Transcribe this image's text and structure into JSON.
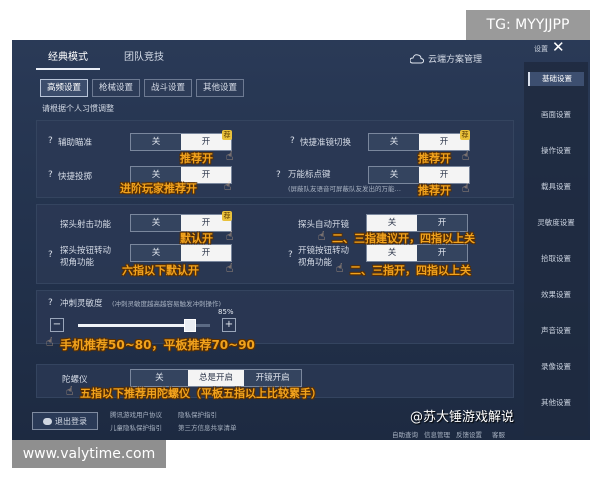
{
  "watermark_top": "TG: MYYJJPP",
  "watermark_bottom": "www.valytime.com",
  "watermark_corner": "@苏大锤游戏解说",
  "header": {
    "tabs": [
      "经典模式",
      "团队竞技"
    ],
    "cloud_label": "云端方案管理",
    "corner_text": "设置",
    "close_glyph": "✕"
  },
  "subtabs": [
    "高频设置",
    "枪械设置",
    "战斗设置",
    "其他设置"
  ],
  "instruction": "请根据个人习惯调整",
  "toggle": {
    "off": "关",
    "on": "开"
  },
  "settings": {
    "aim_assist": "辅助瞄准",
    "quick_throw": "快捷投掷",
    "quick_scope_switch": "快捷准镜切换",
    "universal_marker": "万能标点键",
    "universal_marker_note": "(屏蔽队友语音可屏蔽队友发出的万能…",
    "peek_fire": "探头射击功能",
    "peek_auto_scope": "探头自动开镜",
    "peek_button_line1": "探头按钮转动",
    "peek_button_line2": "视角功能",
    "scope_button_line1": "开镜按钮转动",
    "scope_button_line2": "视角功能",
    "sensitivity": "冲刺灵敏度",
    "sensitivity_note": "(冲刺灵敏度越高越容易触发冲刺操作)",
    "sensitivity_value": "85%",
    "sensitivity_level": 0.85,
    "minus": "−",
    "plus": "+",
    "gyro": "陀螺仪",
    "gyro_options": [
      "关",
      "开启",
      "开镜开启"
    ],
    "gyro_option_prefix": "总是"
  },
  "annotations": {
    "a1": "推荐开",
    "a2": "进阶玩家推荐开",
    "a3": "推荐开",
    "a4": "推荐开",
    "a5": "默认开",
    "a6": "二、三指建议开，四指以上关",
    "a7": "六指以下默认开",
    "a8": "二、三指开，四指以上关",
    "a9": "手机推荐50~80，平板推荐70~90",
    "a10": "五指以下推荐用陀螺仪（平板五指以上比较累手）"
  },
  "right_menu": [
    "基础设置",
    "画面设置",
    "操作设置",
    "载具设置",
    "灵敏度设置",
    "拾取设置",
    "效果设置",
    "声音设置",
    "录像设置",
    "其他设置"
  ],
  "footer": {
    "logout": "退出登录",
    "links": [
      "腾讯游戏用户协议",
      "隐私保护指引",
      "儿童隐私保护指引",
      "第三方信息共享清单"
    ],
    "bottom_right": [
      "自助查询",
      "信息管理",
      "反馈设置",
      "客服"
    ]
  },
  "colors": {
    "annotation": "#f2a31d",
    "panel_bg": "#22314b",
    "active_toggle": "#f4f4f4"
  }
}
